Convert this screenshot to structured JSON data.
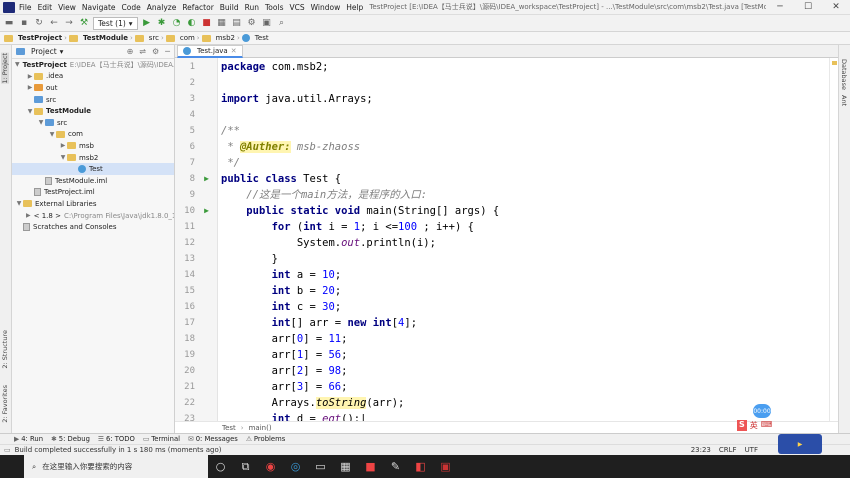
{
  "window": {
    "menu": [
      "File",
      "Edit",
      "View",
      "Navigate",
      "Code",
      "Analyze",
      "Refactor",
      "Build",
      "Run",
      "Tools",
      "VCS",
      "Window",
      "Help"
    ],
    "title": "TestProject [E:\\IDEA【马士兵说】\\源码\\IDEA_workspace\\TestProject] - ...\\TestModule\\src\\com\\msb2\\Test.java [TestModule]"
  },
  "toolbar": {
    "run_config": "Test (1)"
  },
  "navbar": [
    "TestProject",
    "TestModule",
    "src",
    "com",
    "msb2",
    "Test"
  ],
  "project_panel": {
    "title": "Project",
    "tree": [
      {
        "label": "TestProject",
        "path": "E:\\IDEA【马士兵说】\\源码\\IDEA...",
        "bold": true,
        "indent": 0,
        "arrow": "▼",
        "icon": "folder"
      },
      {
        "label": ".idea",
        "indent": 1,
        "arrow": "▶",
        "icon": "folder"
      },
      {
        "label": "out",
        "indent": 1,
        "arrow": "▶",
        "icon": "folder-orange"
      },
      {
        "label": "src",
        "indent": 1,
        "arrow": "",
        "icon": "folder-blue"
      },
      {
        "label": "TestModule",
        "bold": true,
        "indent": 1,
        "arrow": "▼",
        "icon": "folder"
      },
      {
        "label": "src",
        "indent": 2,
        "arrow": "▼",
        "icon": "folder-blue"
      },
      {
        "label": "com",
        "indent": 3,
        "arrow": "▼",
        "icon": "folder"
      },
      {
        "label": "msb",
        "indent": 4,
        "arrow": "▶",
        "icon": "folder"
      },
      {
        "label": "msb2",
        "indent": 4,
        "arrow": "▼",
        "icon": "folder"
      },
      {
        "label": "Test",
        "indent": 5,
        "arrow": "",
        "icon": "class",
        "selected": true
      },
      {
        "label": "TestModule.iml",
        "indent": 2,
        "arrow": "",
        "icon": "file"
      },
      {
        "label": "TestProject.iml",
        "indent": 1,
        "arrow": "",
        "icon": "file"
      },
      {
        "label": "External Libraries",
        "indent": 0,
        "arrow": "▼",
        "icon": "library"
      },
      {
        "label": "< 1.8 >",
        "path": "C:\\Program Files\\Java\\jdk1.8.0_1",
        "indent": 1,
        "arrow": "▶",
        "icon": "library"
      },
      {
        "label": "Scratches and Consoles",
        "indent": 0,
        "arrow": "",
        "icon": "scratch"
      }
    ]
  },
  "left_strip": [
    "1: Project",
    "2: Structure",
    "2: Favorites"
  ],
  "right_strip": [
    "Database",
    "Ant"
  ],
  "editor": {
    "tab": "Test.java",
    "line_numbers": [
      "1",
      "2",
      "3",
      "4",
      "5",
      "6",
      "7",
      "8",
      "9",
      "10",
      "11",
      "12",
      "13",
      "14",
      "15",
      "16",
      "17",
      "18",
      "19",
      "20",
      "21",
      "22",
      "23"
    ],
    "run_marks": [
      8,
      10
    ],
    "crumbs": [
      "Test",
      "main()"
    ]
  },
  "tool_windows": [
    "4: Run",
    "5: Debug",
    "6: TODO",
    "Terminal",
    "0: Messages",
    "Problems"
  ],
  "status": {
    "message": "Build completed successfully in 1 s 180 ms (moments ago)",
    "position": "23:23",
    "line_sep": "CRLF",
    "encoding": "UTF"
  },
  "taskbar": {
    "search_placeholder": "在这里输入你要搜索的内容"
  },
  "overlay": {
    "bubble": "00:00",
    "ime": "英"
  }
}
